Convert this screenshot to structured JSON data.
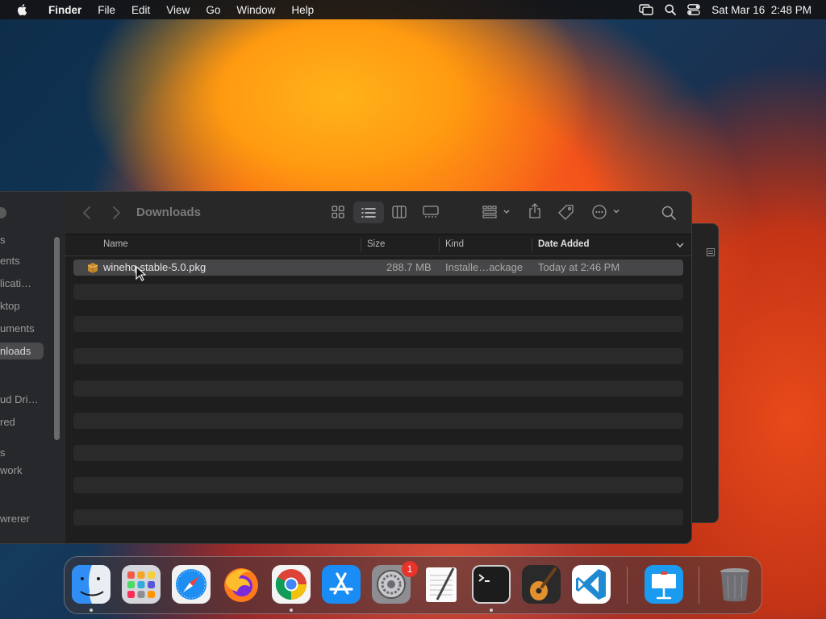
{
  "menubar": {
    "app_name": "Finder",
    "items": [
      "File",
      "Edit",
      "View",
      "Go",
      "Window",
      "Help"
    ],
    "clock": "Sat Mar 16  2:48 PM"
  },
  "sidebar": {
    "items": [
      {
        "label": "s"
      },
      {
        "label": "ents"
      },
      {
        "label": "licati…"
      },
      {
        "label": "ktop"
      },
      {
        "label": "uments"
      },
      {
        "label": "nloads"
      },
      {
        "label": "ud Dri…"
      },
      {
        "label": "red"
      },
      {
        "label": "s"
      },
      {
        "label": "work"
      },
      {
        "label": "wrerer"
      }
    ]
  },
  "finder": {
    "title": "Downloads",
    "columns": {
      "name": "Name",
      "size": "Size",
      "kind": "Kind",
      "date_added": "Date Added"
    },
    "files": [
      {
        "name": "winehq-stable-5.0.pkg",
        "size": "288.7 MB",
        "kind": "Installe…ackage",
        "date_added": "Today at 2:46 PM"
      }
    ]
  },
  "dock": {
    "apps": [
      "Finder",
      "Launchpad",
      "Safari",
      "Firefox",
      "Google Chrome",
      "App Store",
      "System Preferences",
      "TextEdit",
      "Terminal",
      "GarageBand",
      "Visual Studio Code",
      "Keynote",
      "Trash"
    ],
    "system_preferences_badge": "1"
  },
  "colors": {
    "menubar_bg": "#141416",
    "window_bg": "#1e1e1e",
    "selection": "#464648",
    "badge": "#e8322a"
  }
}
